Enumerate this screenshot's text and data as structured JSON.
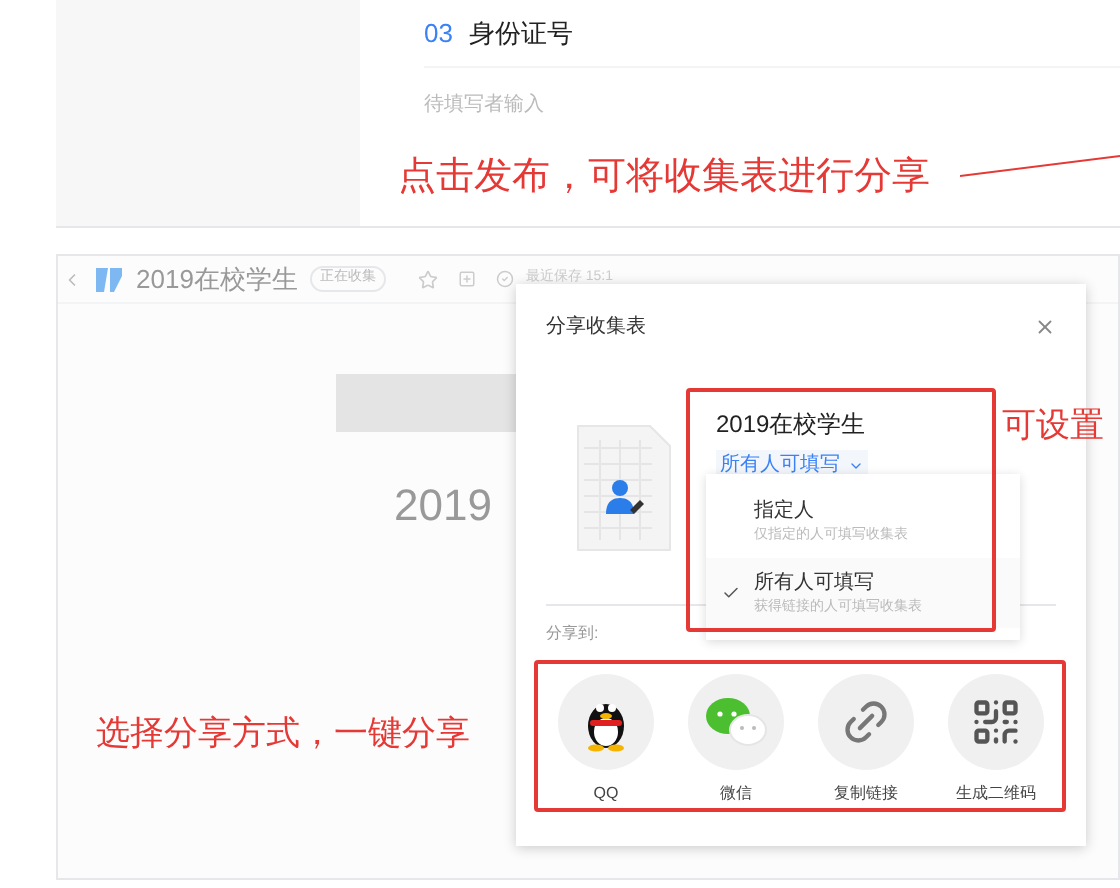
{
  "top_panel": {
    "question": {
      "number": "03",
      "title": "身份证号",
      "placeholder": "待填写者输入"
    }
  },
  "app": {
    "title": "2019在校学生",
    "status_badge": "正在收集",
    "saved": "最近保存 15:1",
    "form_title": "2019"
  },
  "dialog": {
    "title": "分享收集表",
    "form_name": "2019在校学生",
    "permission": "所有人可填写",
    "options": [
      {
        "label": "指定人",
        "description": "仅指定的人可填写收集表",
        "selected": false
      },
      {
        "label": "所有人可填写",
        "description": "获得链接的人可填写收集表",
        "selected": true
      }
    ],
    "share_label": "分享到:",
    "share_targets": [
      {
        "kind": "qq",
        "label": "QQ"
      },
      {
        "kind": "wechat",
        "label": "微信"
      },
      {
        "kind": "link",
        "label": "复制链接"
      },
      {
        "kind": "qrcode",
        "label": "生成二维码"
      }
    ]
  },
  "annotations": {
    "publish": "点击发布，可将收集表进行分享",
    "permission": "可设置",
    "share": "选择分享方式，一键分享"
  }
}
